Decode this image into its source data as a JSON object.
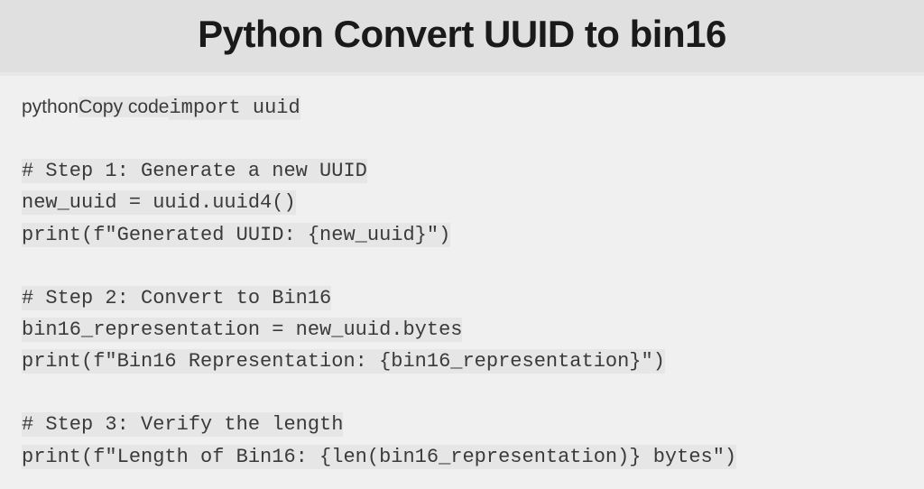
{
  "header": {
    "title": "Python Convert UUID to bin16"
  },
  "code": {
    "prefix_a": "python",
    "prefix_b": "Copy code",
    "line1": "import uuid",
    "line2": "# Step 1: Generate a new UUID",
    "line3": "new_uuid = uuid.uuid4()",
    "line4": "print(f\"Generated UUID: {new_uuid}\")",
    "line5": "# Step 2: Convert to Bin16",
    "line6": "bin16_representation = new_uuid.bytes",
    "line7": "print(f\"Bin16 Representation: {bin16_representation}\")",
    "line8": "# Step 3: Verify the length",
    "line9": "print(f\"Length of Bin16: {len(bin16_representation)} bytes\")"
  }
}
